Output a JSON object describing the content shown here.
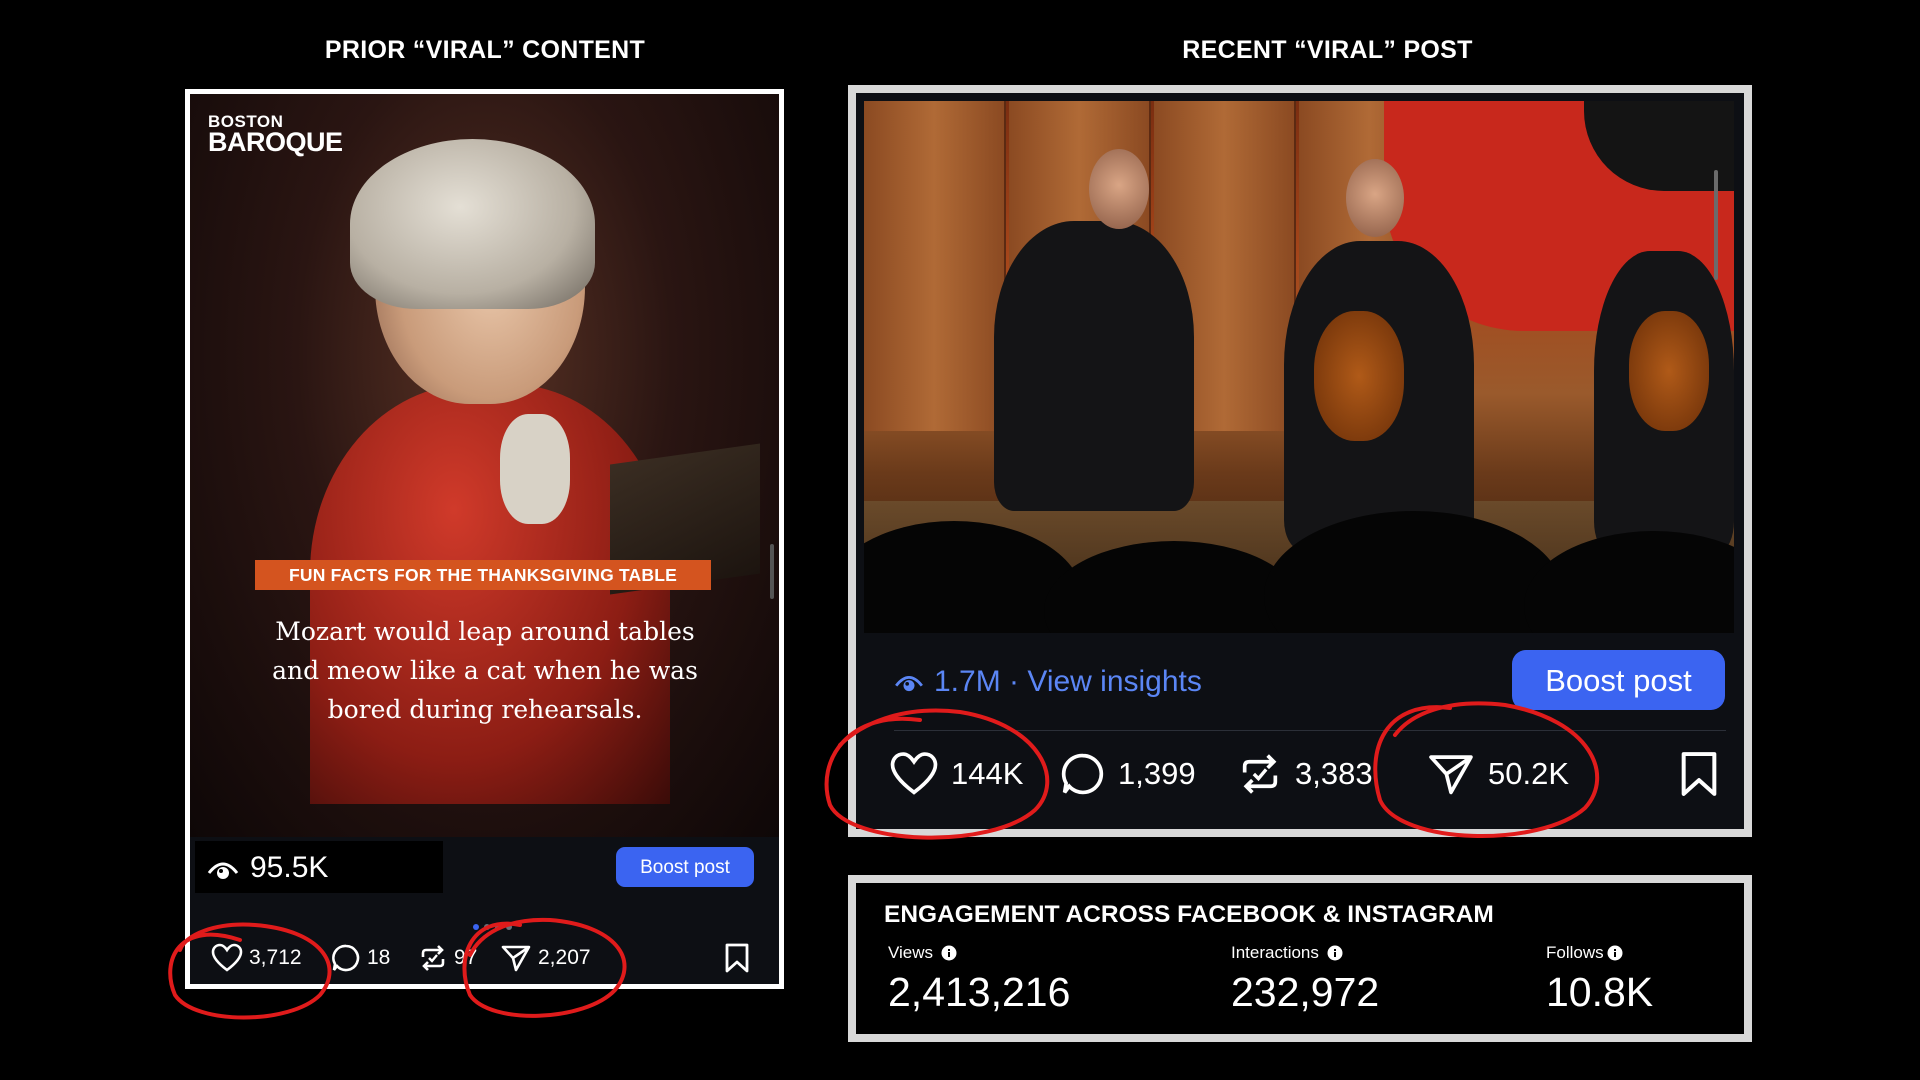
{
  "headings": {
    "left": "PRIOR “VIRAL” CONTENT",
    "right": "RECENT “VIRAL” POST"
  },
  "left_post": {
    "logo_top": "BOSTON",
    "logo_bottom": "BAROQUE",
    "label": "FUN FACTS FOR THE THANKSGIVING TABLE",
    "fact_lines": [
      "Mozart would leap around tables",
      "and meow like a cat when he was",
      "bored during rehearsals."
    ],
    "views": "95.5K",
    "boost_label": "Boost post",
    "likes": "3,712",
    "comments": "18",
    "reposts": "97",
    "shares": "2,207",
    "carousel_dots": 4,
    "active_dot": 0
  },
  "right_post": {
    "insights_text": "1.7M · View insights",
    "boost_label": "Boost post",
    "likes": "144K",
    "comments": "1,399",
    "reposts": "3,383",
    "shares": "50.2K"
  },
  "engagement": {
    "title": "ENGAGEMENT ACROSS FACEBOOK & INSTAGRAM",
    "metrics": [
      {
        "label": "Views",
        "value": "2,413,216"
      },
      {
        "label": "Interactions",
        "value": "232,972"
      },
      {
        "label": "Follows",
        "value": "10.8K"
      }
    ]
  },
  "colors": {
    "accent_blue": "#3b64f1",
    "insights_blue": "#5b86f5",
    "label_orange": "#d4541f",
    "annotation_red": "#e01b1b"
  },
  "icons": [
    "eye-icon",
    "heart-icon",
    "comment-icon",
    "repost-icon",
    "share-icon",
    "bookmark-icon",
    "info-icon"
  ]
}
